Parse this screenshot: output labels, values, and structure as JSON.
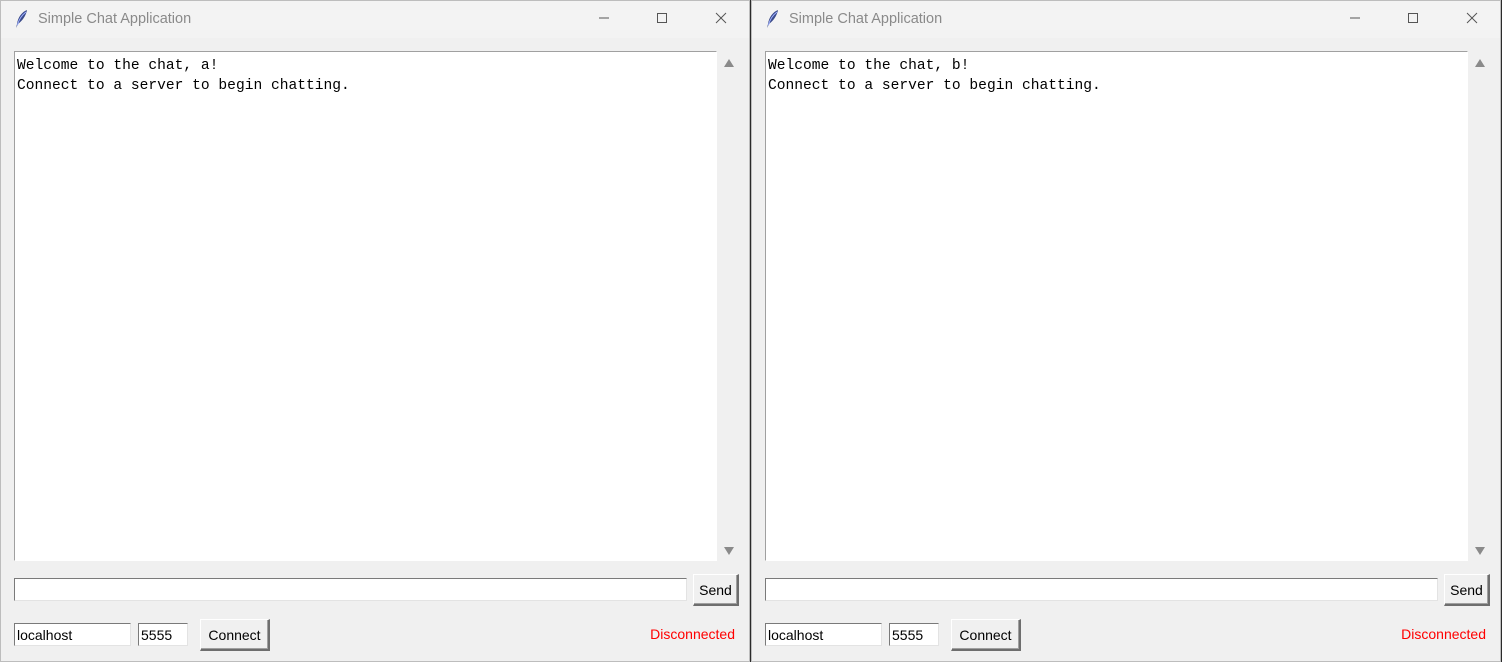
{
  "windows": [
    {
      "title": "Simple Chat Application",
      "chat_lines": "Welcome to the chat, a!\nConnect to a server to begin chatting.",
      "message_input": "",
      "send_label": "Send",
      "host": "localhost",
      "port": "5555",
      "connect_label": "Connect",
      "status": "Disconnected"
    },
    {
      "title": "Simple Chat Application",
      "chat_lines": "Welcome to the chat, b!\nConnect to a server to begin chatting.",
      "message_input": "",
      "send_label": "Send",
      "host": "localhost",
      "port": "5555",
      "connect_label": "Connect",
      "status": "Disconnected"
    }
  ],
  "icons": {
    "app": "feather-icon",
    "minimize": "minimize-icon",
    "maximize": "maximize-icon",
    "close": "close-icon",
    "scroll_up": "arrow-up-icon",
    "scroll_down": "arrow-down-icon"
  },
  "colors": {
    "status_disconnected": "#ff0000",
    "window_bg": "#f0f0f0",
    "chat_bg": "#ffffff"
  }
}
